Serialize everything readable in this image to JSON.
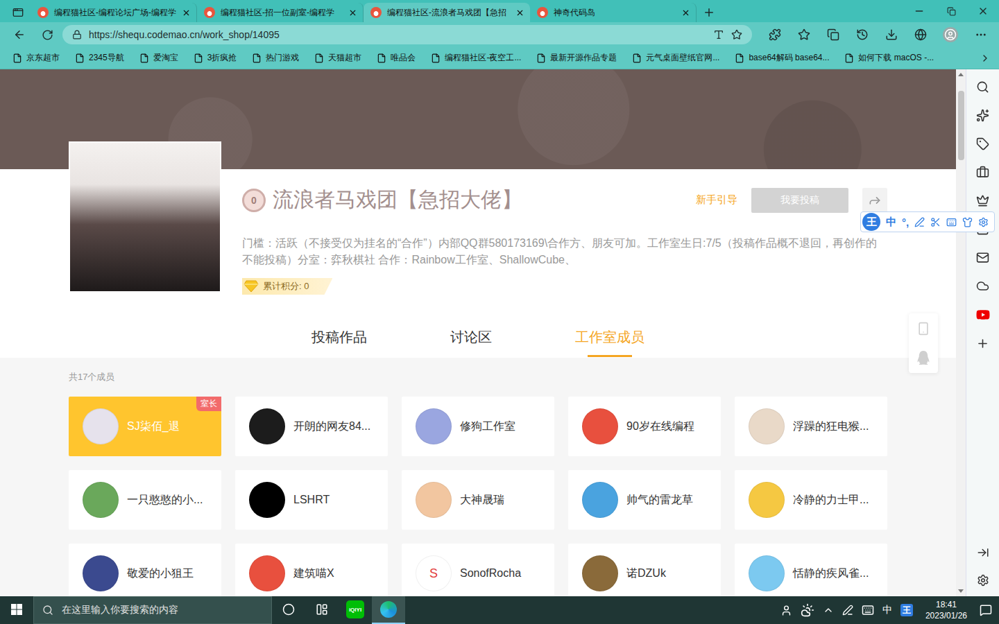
{
  "browser": {
    "tabs": [
      {
        "title": "编程猫社区-编程论坛广场-编程学",
        "selected": false
      },
      {
        "title": "编程猫社区-招一位副室-编程学",
        "selected": false
      },
      {
        "title": "编程猫社区-流浪者马戏团【急招",
        "selected": true
      },
      {
        "title": "神奇代码岛",
        "selected": false
      }
    ],
    "address": "https://shequ.codemao.cn/work_shop/14095",
    "bookmarks": [
      "京东超市",
      "2345导航",
      "爱淘宝",
      "3折疯抢",
      "热门游戏",
      "天猫超市",
      "唯品会",
      "编程猫社区-夜空工...",
      "最新开源作品专题",
      "元气桌面壁纸官网...",
      "base64解码 base64...",
      "如何下载 macOS -..."
    ]
  },
  "studio": {
    "name": "流浪者马戏团【急招大佬】",
    "level_badge": "0",
    "guide_link": "新手引导",
    "submit_button": {
      "label": "我要投稿",
      "disabled": true
    },
    "description": "门槛：活跃（不接受仅为挂名的“合作”）内部QQ群580173169\\合作方、朋友可加。工作室生日:7/5（投稿作品概不退回，再创作的不能投稿）分室：弈秋棋社 合作：Rainbow工作室、ShallowCube、",
    "score": "累计积分: 0"
  },
  "page_tabs": [
    {
      "label": "投稿作品",
      "selected": false
    },
    {
      "label": "讨论区",
      "selected": false
    },
    {
      "label": "工作室成员",
      "selected": true
    }
  ],
  "members": {
    "count": "共17个成员",
    "list": [
      {
        "name": "SJ柒佰_退",
        "role": "室长",
        "highlighted": true,
        "avatar_letter": "",
        "color": "#e6e2ec"
      },
      {
        "name": "开朗的网友84...",
        "role": "",
        "highlighted": false,
        "avatar_letter": "",
        "color": "#1c1c1c"
      },
      {
        "name": "修狗工作室",
        "role": "",
        "highlighted": false,
        "avatar_letter": "",
        "color": "#9aa6e0"
      },
      {
        "name": "90岁在线编程",
        "role": "",
        "highlighted": false,
        "avatar_letter": "",
        "color": "#e8503e"
      },
      {
        "name": "浮躁的狂电猴...",
        "role": "",
        "highlighted": false,
        "avatar_letter": "",
        "color": "#e9d9c8"
      },
      {
        "name": "一只憨憨的小...",
        "role": "",
        "highlighted": false,
        "avatar_letter": "",
        "color": "#6aa85b"
      },
      {
        "name": "LSHRT",
        "role": "",
        "highlighted": false,
        "avatar_letter": "",
        "color": "#000000"
      },
      {
        "name": "大神晟瑞",
        "role": "",
        "highlighted": false,
        "avatar_letter": "",
        "color": "#f2c6a0"
      },
      {
        "name": "帅气的雷龙草",
        "role": "",
        "highlighted": false,
        "avatar_letter": "",
        "color": "#4aa3df"
      },
      {
        "name": "冷静的力士甲...",
        "role": "",
        "highlighted": false,
        "avatar_letter": "",
        "color": "#f5c842"
      },
      {
        "name": "敬爱的小狙王",
        "role": "",
        "highlighted": false,
        "avatar_letter": "",
        "color": "#3b4a8f"
      },
      {
        "name": "建筑喵X",
        "role": "",
        "highlighted": false,
        "avatar_letter": "",
        "color": "#e8503e"
      },
      {
        "name": "SonofRocha",
        "role": "",
        "highlighted": false,
        "avatar_letter": "S",
        "color": "#ffffff"
      },
      {
        "name": "诺DZUk",
        "role": "",
        "highlighted": false,
        "avatar_letter": "",
        "color": "#8a6a3a"
      },
      {
        "name": "恬静的疾风雀...",
        "role": "",
        "highlighted": false,
        "avatar_letter": "",
        "color": "#7cc9f0"
      }
    ]
  },
  "ime_toolbar": {
    "logo": "王",
    "mode": "中",
    "punct": "°,"
  },
  "taskbar": {
    "search_placeholder": "在这里输入你要搜索的内容",
    "app_label": "iQIYI",
    "ime_mode": "中",
    "ime_logo": "王",
    "time": "18:41",
    "date": "2023/01/26"
  }
}
